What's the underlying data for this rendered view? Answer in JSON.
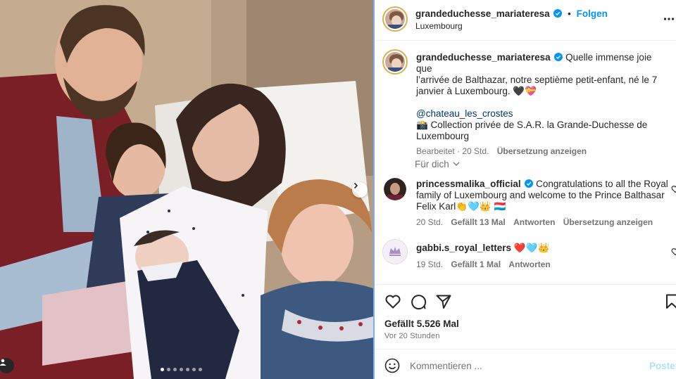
{
  "post": {
    "username": "grandeduchesse_mariateresa",
    "follow_label": "Folgen",
    "location": "Luxembourg",
    "more_icon": "more-horizontal-icon",
    "carousel": {
      "slide_count": 7,
      "active_index": 0
    }
  },
  "caption": {
    "username": "grandeduchesse_mariateresa",
    "text_line1": "Quelle immense joie que",
    "text_line2": "l’arrivée de Balthazar, notre septième petit-enfant, né le 7",
    "text_line3": "janvier à Luxembourg. 🖤💝",
    "mention": "@chateau_les_crostes",
    "credit_line1": "📸 Collection privée de S.A.R. la Grande-Duchesse de",
    "credit_line2": "Luxembourg",
    "edited": "Bearbeitet · 20 Std.",
    "translate": "Übersetzung anzeigen"
  },
  "for_you": {
    "label": "Für dich"
  },
  "comments": [
    {
      "username": "princessmalika_official",
      "verified": true,
      "line1": "Congratulations to all the Royal",
      "line2": "family of Luxembourg and welcome to the Prince Balthasar",
      "line3": "Felix Karl👏🩵👑 🇱🇺",
      "time": "20 Std.",
      "likes": "Gefällt 13 Mal",
      "reply": "Antworten",
      "translate": "Übersetzung anzeigen"
    },
    {
      "username": "gabbi.s_royal_letters",
      "verified": false,
      "text": "❤️🩵👑",
      "time": "19 Std.",
      "likes": "Gefällt 1 Mal",
      "reply": "Antworten"
    }
  ],
  "actions": {
    "likes": "Gefällt 5.526 Mal",
    "timestamp": "Vor 20 Stunden"
  },
  "comment_box": {
    "placeholder": "Kommentieren ...",
    "post_label": "Posten"
  },
  "colors": {
    "link": "#0095f6",
    "verified": "#0095f6",
    "text": "#262626",
    "muted": "#737373"
  }
}
